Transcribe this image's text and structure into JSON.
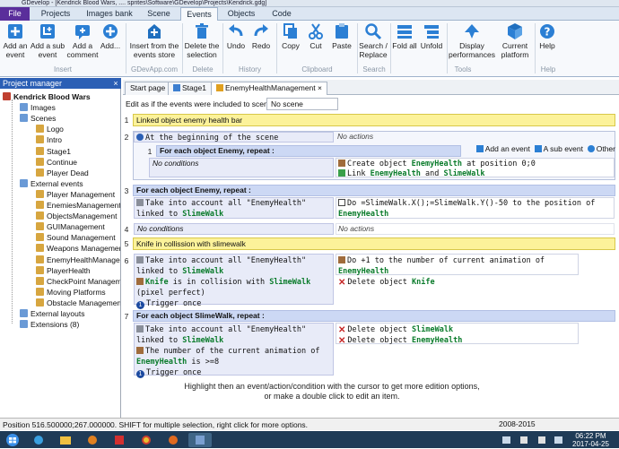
{
  "window": {
    "title": "GDevelop - [Kendrick Blood Wars, .... sprites\\Software\\GDevelop\\Projects\\Kendrick.gdg]"
  },
  "ribbon_tabs": [
    "File",
    "Projects",
    "Images bank",
    "Scene",
    "Events",
    "Objects",
    "Code"
  ],
  "ribbon": {
    "buttons": [
      {
        "label": "Add an event",
        "icon": "add-event-icon"
      },
      {
        "label": "Add a sub event",
        "icon": "add-sub-event-icon"
      },
      {
        "label": "Add a comment",
        "icon": "add-comment-icon"
      },
      {
        "label": "Add...",
        "icon": "add-more-icon"
      },
      {
        "label": "Insert from the events store",
        "icon": "events-store-icon"
      },
      {
        "label": "Delete the selection",
        "icon": "delete-icon"
      },
      {
        "label": "Undo",
        "icon": "undo-icon"
      },
      {
        "label": "Redo",
        "icon": "redo-icon"
      },
      {
        "label": "Copy",
        "icon": "copy-icon"
      },
      {
        "label": "Cut",
        "icon": "cut-icon"
      },
      {
        "label": "Paste",
        "icon": "paste-icon"
      },
      {
        "label": "Search / Replace",
        "icon": "search-icon"
      },
      {
        "label": "Fold all",
        "icon": "fold-icon"
      },
      {
        "label": "Unfold",
        "icon": "unfold-icon"
      },
      {
        "label": "Display performances",
        "icon": "performance-icon"
      },
      {
        "label": "Current platform",
        "icon": "platform-icon"
      },
      {
        "label": "Help",
        "icon": "help-icon"
      }
    ],
    "groups": [
      "Insert",
      "GDevApp.com",
      "Delete",
      "History",
      "Clipboard",
      "Search",
      "Tools",
      "Help"
    ]
  },
  "project_manager": {
    "title": "Project manager",
    "tree": [
      {
        "label": "Kendrick Blood Wars",
        "level": 0
      },
      {
        "label": "Images",
        "level": 1
      },
      {
        "label": "Scenes",
        "level": 1
      },
      {
        "label": "Logo",
        "level": 2
      },
      {
        "label": "Intro",
        "level": 2
      },
      {
        "label": "Stage1",
        "level": 2
      },
      {
        "label": "Continue",
        "level": 2
      },
      {
        "label": "Player Dead",
        "level": 2
      },
      {
        "label": "External events",
        "level": 1
      },
      {
        "label": "Player Management",
        "level": 2
      },
      {
        "label": "EnemiesManagement",
        "level": 2
      },
      {
        "label": "ObjectsManagement",
        "level": 2
      },
      {
        "label": "GUIManagement",
        "level": 2
      },
      {
        "label": "Sound Management",
        "level": 2
      },
      {
        "label": "Weapons Management",
        "level": 2
      },
      {
        "label": "EnemyHealthManagement",
        "level": 2
      },
      {
        "label": "PlayerHealth",
        "level": 2
      },
      {
        "label": "CheckPoint Management",
        "level": 2
      },
      {
        "label": "Moving Platforms",
        "level": 2
      },
      {
        "label": "Obstacle Management",
        "level": 2
      },
      {
        "label": "External layouts",
        "level": 1
      },
      {
        "label": "Extensions (8)",
        "level": 1
      }
    ]
  },
  "doc_tabs": [
    "Start page",
    "Stage1",
    "EnemyHealthManagement"
  ],
  "scene_bar": {
    "label": "Edit as if the events were included to scene :",
    "value": "No scene"
  },
  "events": {
    "e1": {
      "num": "1",
      "text": "Linked object enemy health bar"
    },
    "e2": {
      "num": "2",
      "cond": "At the beginning of the scene",
      "act": "No actions"
    },
    "e2_toolbar": {
      "add_event": "Add an event",
      "sub_event": "A sub event",
      "other": "Other"
    },
    "e2_sub": {
      "num": "1",
      "header": "For each object Enemy, repeat :",
      "cond": "No conditions",
      "act1_a": "Create object ",
      "act1_b": "EnemyHealth",
      "act1_c": " at position 0;0",
      "act2_a": "Link ",
      "act2_b": "EnemyHealth",
      "act2_c": " and ",
      "act2_d": "SlimeWalk"
    },
    "e3": {
      "num": "3",
      "header": "For each object Enemy, repeat :",
      "cond_a": "Take into account all \"EnemyHealth\" linked to ",
      "cond_b": "SlimeWalk",
      "act_a": "Do =SlimeWalk.X();=SlimeWalk.Y()-50 to the position of ",
      "act_b": "EnemyHealth"
    },
    "e4": {
      "num": "4",
      "cond": "No conditions",
      "act": "No actions"
    },
    "e5": {
      "num": "5",
      "text": "Knife in collission with slimewalk"
    },
    "e6": {
      "num": "6",
      "c1_a": "Take into account all \"EnemyHealth\" linked to ",
      "c1_b": "SlimeWalk",
      "c2_a": "Knife",
      "c2_b": " is in collision with ",
      "c2_c": "SlimeWalk",
      "c2_d": " (pixel perfect)",
      "c3": "Trigger once",
      "a1_a": "Do +1 to the number of current animation of ",
      "a1_b": "EnemyHealth",
      "a2_a": "Delete object ",
      "a2_b": "Knife"
    },
    "e7": {
      "num": "7",
      "header": "For each object SlimeWalk, repeat :",
      "c1_a": "Take into account all \"EnemyHealth\" linked to ",
      "c1_b": "SlimeWalk",
      "c2_a": "The number of the current animation of ",
      "c2_b": "EnemyHealth",
      "c2_c": " is >=8",
      "c3": "Trigger once",
      "a1_a": "Delete object ",
      "a1_b": "SlimeWalk",
      "a2_a": "Delete object ",
      "a2_b": "EnemyHealth"
    }
  },
  "hint": {
    "line1": "Highlight then an event/action/condition with the cursor to get more edition options,",
    "line2": "or make a double click to edit an item."
  },
  "status": {
    "text": "Position 516.500000;267.000000. SHIFT for multiple selection, right click for more options.",
    "year": "2008-2015"
  },
  "clock": {
    "time": "06:22 PM",
    "date": "2017-04-25"
  },
  "colors": {
    "accent": "#2b5fb5",
    "file_tab": "#5a2e9b",
    "comment": "#fcf29a",
    "foreach": "#ccd8f4",
    "object_name": "#0a7b2b"
  }
}
